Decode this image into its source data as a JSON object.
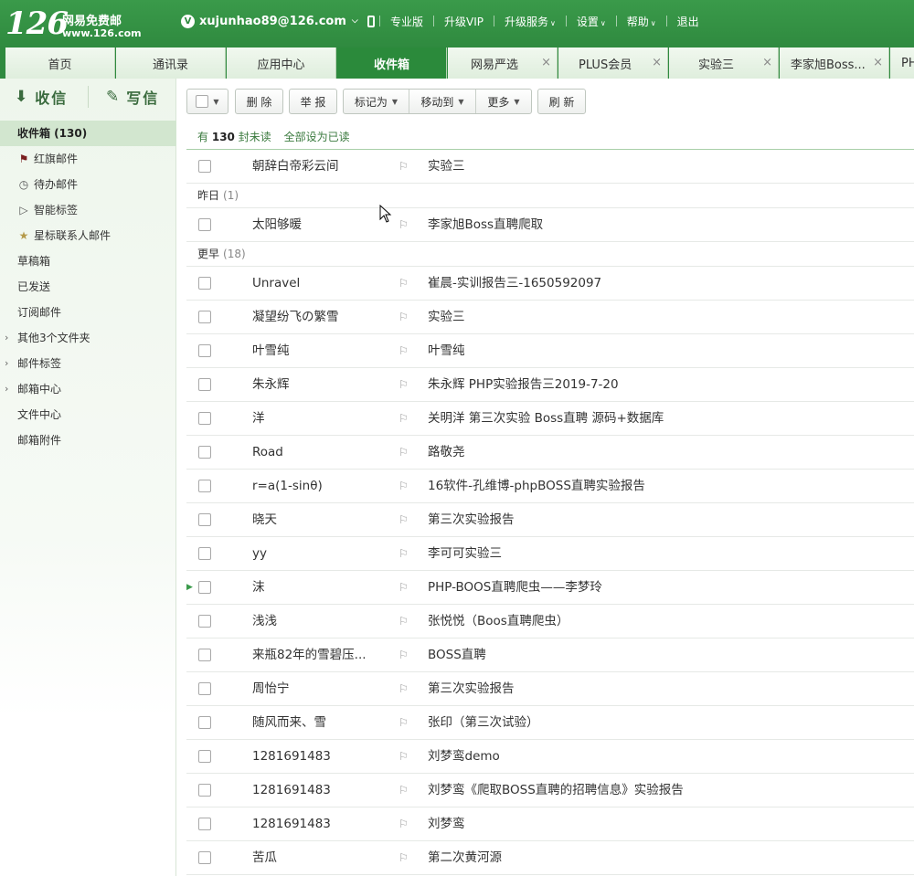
{
  "header": {
    "logo_number": "126",
    "logo_name": "网易免费邮",
    "logo_url": "www.126.com",
    "account_badge": "V",
    "account": "xujunhao89@126.com",
    "links": [
      "专业版",
      "升级VIP",
      "升级服务",
      "设置",
      "帮助",
      "退出"
    ]
  },
  "tabs": [
    {
      "label": "首页"
    },
    {
      "label": "通讯录"
    },
    {
      "label": "应用中心"
    },
    {
      "label": "收件箱"
    },
    {
      "label": "网易严选"
    },
    {
      "label": "PLUS会员"
    },
    {
      "label": "实验三"
    },
    {
      "label": "李家旭Boss..."
    },
    {
      "label": "PH"
    }
  ],
  "tab_close_glyph": "×",
  "sidebar": {
    "receive_label": "收信",
    "write_label": "写信",
    "items": [
      {
        "label": "收件箱 (130)",
        "icon": ""
      },
      {
        "label": "红旗邮件",
        "icon": "flag-icon"
      },
      {
        "label": "待办邮件",
        "icon": "clock-icon"
      },
      {
        "label": "智能标签",
        "icon": "tag-icon"
      },
      {
        "label": "星标联系人邮件",
        "icon": "star-icon"
      },
      {
        "label": "草稿箱",
        "icon": ""
      },
      {
        "label": "已发送",
        "icon": ""
      },
      {
        "label": "订阅邮件",
        "icon": ""
      },
      {
        "label": "其他3个文件夹",
        "icon": "expand-arrow-icon"
      },
      {
        "label": "邮件标签",
        "icon": "expand-arrow-icon"
      },
      {
        "label": "邮箱中心",
        "icon": "expand-arrow-icon"
      },
      {
        "label": "文件中心",
        "icon": ""
      },
      {
        "label": "邮箱附件",
        "icon": ""
      }
    ]
  },
  "toolbar": {
    "delete": "删 除",
    "report": "举 报",
    "mark_as": "标记为",
    "move_to": "移动到",
    "more": "更多",
    "refresh": "刷 新"
  },
  "unread": {
    "prefix": "有",
    "count": "130",
    "suffix": "封未读",
    "mark_all": "全部设为已读"
  },
  "groups": {
    "yesterday": {
      "label": "昨日",
      "count": "(1)"
    },
    "earlier": {
      "label": "更早",
      "count": "(18)"
    }
  },
  "mails_today": [
    {
      "from": "朝辞白帝彩云间",
      "subject": "实验三"
    }
  ],
  "mails_yesterday": [
    {
      "from": "太阳够暖",
      "subject": "李家旭Boss直聘爬取"
    }
  ],
  "mails_earlier": [
    {
      "from": "Unravel",
      "subject": "崔晨-实训报告三-1650592097"
    },
    {
      "from": "凝望纷飞の繁雪",
      "subject": "实验三"
    },
    {
      "from": "叶雪纯",
      "subject": "叶雪纯"
    },
    {
      "from": "朱永辉",
      "subject": "朱永辉 PHP实验报告三2019-7-20"
    },
    {
      "from": "洋",
      "subject": "关明洋 第三次实验 Boss直聘 源码+数据库"
    },
    {
      "from": "Road",
      "subject": "路敬尧"
    },
    {
      "from": "r=a(1-sinθ)",
      "subject": "16软件-孔维博-phpBOSS直聘实验报告"
    },
    {
      "from": "晓天",
      "subject": "第三次实验报告"
    },
    {
      "from": "yy",
      "subject": "李可可实验三"
    },
    {
      "from": "沫",
      "subject": "PHP-BOOS直聘爬虫——李梦玲"
    },
    {
      "from": "浅浅",
      "subject": "张悦悦（Boos直聘爬虫）"
    },
    {
      "from": "来瓶82年的雪碧压...",
      "subject": "BOSS直聘"
    },
    {
      "from": "周怡宁",
      "subject": "第三次实验报告"
    },
    {
      "from": "随风而来、雪",
      "subject": "张印（第三次试验）"
    },
    {
      "from": "1281691483",
      "subject": "刘梦鸾demo"
    },
    {
      "from": "1281691483",
      "subject": "刘梦鸾《爬取BOSS直聘的招聘信息》实验报告"
    },
    {
      "from": "1281691483",
      "subject": "刘梦鸾"
    },
    {
      "from": "苦瓜",
      "subject": "第二次黄河源"
    }
  ],
  "colors": {
    "brand_green": "#2f8a3f",
    "active_tab": "#2b8a3b"
  }
}
